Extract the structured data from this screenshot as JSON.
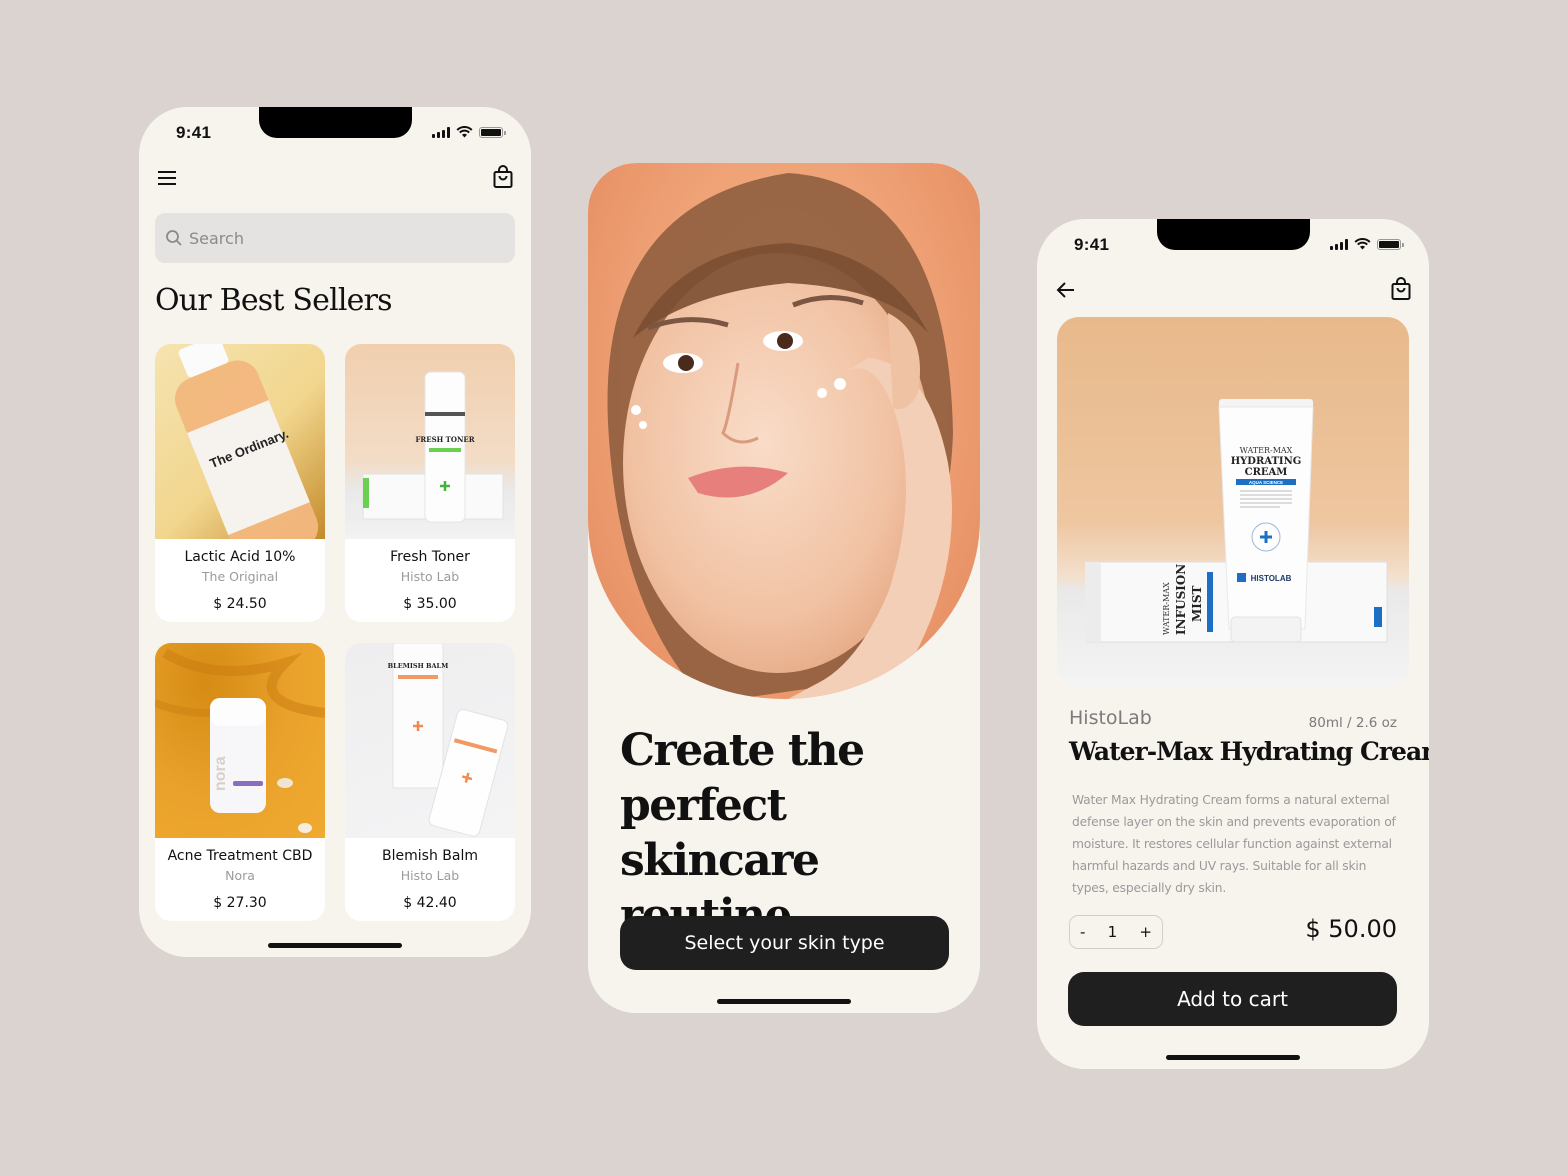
{
  "colors": {
    "background": "#dbd3cf",
    "phone_bg": "#f7f4ee",
    "button_dark": "#1f1f1f",
    "muted_text": "#9b9b9b"
  },
  "status_bar": {
    "time": "9:41"
  },
  "home_screen": {
    "menu_icon": "hamburger-menu-icon",
    "bag_icon": "shopping-bag-icon",
    "search": {
      "placeholder": "Search",
      "value": "",
      "icon": "search-icon"
    },
    "section_title": "Our Best Sellers",
    "products": [
      {
        "name": "Lactic Acid 10%",
        "brand": "The Original",
        "price": "$ 24.50",
        "label": "The Ordinary."
      },
      {
        "name": "Fresh Toner",
        "brand": "Histo Lab",
        "price": "$ 35.00",
        "label": "FRESH TONER"
      },
      {
        "name": "Acne Treatment CBD",
        "brand": "Nora",
        "price": "$ 27.30",
        "label": "nora"
      },
      {
        "name": "Blemish Balm",
        "brand": "Histo Lab",
        "price": "$ 42.40",
        "label": "BLEMISH BALM"
      }
    ]
  },
  "onboarding_screen": {
    "headline": "Create the perfect skincare routine.",
    "cta_label": "Select your skin type"
  },
  "product_screen": {
    "back_icon": "arrow-left-icon",
    "bag_icon": "shopping-bag-icon",
    "tube_text": {
      "line1": "WATER-MAX",
      "line2": "HYDRATING",
      "line3": "CREAM",
      "band": "AQUA SCIENCE",
      "logo": "HISTOLAB"
    },
    "box_text": {
      "line1": "WATER-MAX",
      "line2": "INFUSION",
      "line3": "MIST"
    },
    "brand": "HistoLab",
    "size": "80ml / 2.6 oz",
    "title": "Water-Max Hydrating Cream",
    "description": "Water Max Hydrating Cream forms a natural external defense layer on the skin and prevents evaporation of moisture. It restores cellular function against external harmful hazards and UV rays. Suitable for all skin types, especially dry skin.",
    "quantity": "1",
    "decrement_label": "-",
    "increment_label": "+",
    "price": "$ 50.00",
    "add_to_cart_label": "Add to cart"
  }
}
